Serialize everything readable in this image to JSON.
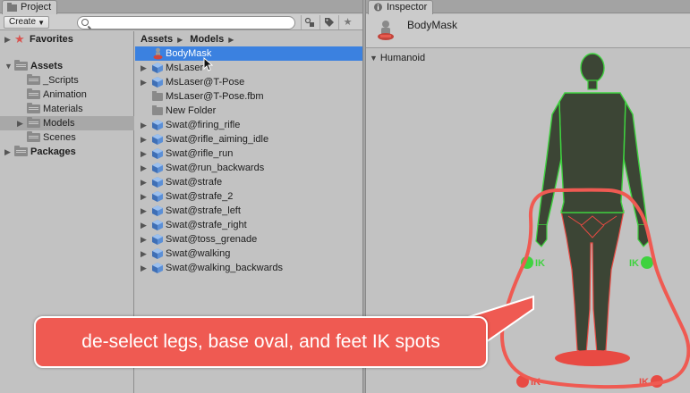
{
  "project_tab": {
    "title": "Project",
    "icon": "folder-icon"
  },
  "inspector_tab": {
    "title": "Inspector",
    "icon": "info-icon"
  },
  "toolbar": {
    "create_label": "Create",
    "search_placeholder": "",
    "filter_icon": "filter-by-type-icon",
    "label_icon": "filter-by-label-icon",
    "favorite_icon": "star-icon"
  },
  "tree": {
    "favorites": "Favorites",
    "assets": "Assets",
    "scripts": "_Scripts",
    "animation": "Animation",
    "materials": "Materials",
    "models": "Models",
    "scenes": "Scenes",
    "packages": "Packages"
  },
  "breadcrumb": {
    "root": "Assets",
    "current": "Models"
  },
  "files": [
    {
      "label": "BodyMask",
      "icon": "avatar-mask-icon",
      "expandable": false,
      "selected": true
    },
    {
      "label": "MsLaser",
      "icon": "model-icon",
      "expandable": true,
      "selected": false
    },
    {
      "label": "MsLaser@T-Pose",
      "icon": "model-icon",
      "expandable": true,
      "selected": false
    },
    {
      "label": "MsLaser@T-Pose.fbm",
      "icon": "folder-icon",
      "expandable": false,
      "selected": false
    },
    {
      "label": "New Folder",
      "icon": "folder-icon",
      "expandable": false,
      "selected": false
    },
    {
      "label": "Swat@firing_rifle",
      "icon": "model-icon",
      "expandable": true,
      "selected": false
    },
    {
      "label": "Swat@rifle_aiming_idle",
      "icon": "model-icon",
      "expandable": true,
      "selected": false
    },
    {
      "label": "Swat@rifle_run",
      "icon": "model-icon",
      "expandable": true,
      "selected": false
    },
    {
      "label": "Swat@run_backwards",
      "icon": "model-icon",
      "expandable": true,
      "selected": false
    },
    {
      "label": "Swat@strafe",
      "icon": "model-icon",
      "expandable": true,
      "selected": false
    },
    {
      "label": "Swat@strafe_2",
      "icon": "model-icon",
      "expandable": true,
      "selected": false
    },
    {
      "label": "Swat@strafe_left",
      "icon": "model-icon",
      "expandable": true,
      "selected": false
    },
    {
      "label": "Swat@strafe_right",
      "icon": "model-icon",
      "expandable": true,
      "selected": false
    },
    {
      "label": "Swat@toss_grenade",
      "icon": "model-icon",
      "expandable": true,
      "selected": false
    },
    {
      "label": "Swat@walking",
      "icon": "model-icon",
      "expandable": true,
      "selected": false
    },
    {
      "label": "Swat@walking_backwards",
      "icon": "model-icon",
      "expandable": true,
      "selected": false
    }
  ],
  "inspector": {
    "asset_name": "BodyMask",
    "section": "Humanoid",
    "ik_label": "IK"
  },
  "annotation": {
    "text": "de-select legs, base oval, and feet IK spots"
  },
  "colors": {
    "selection": "#3b81e0",
    "mask_on": "#3fd23f",
    "mask_off": "#e84a43",
    "figure_body": "#3c4535",
    "callout": "#ef5a52"
  }
}
